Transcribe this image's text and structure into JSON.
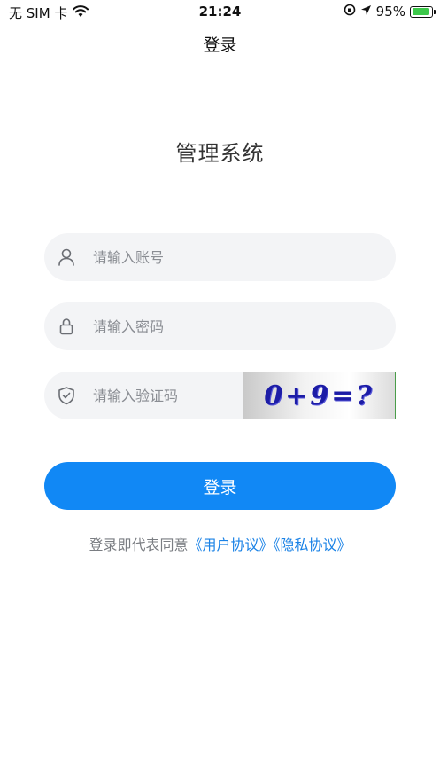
{
  "status_bar": {
    "carrier": "无 SIM 卡",
    "time": "21:24",
    "battery": "95%",
    "battery_level": 0.95
  },
  "nav": {
    "title": "登录"
  },
  "app": {
    "title": "管理系统"
  },
  "form": {
    "username_placeholder": "请输入账号",
    "password_placeholder": "请输入密码",
    "captcha_placeholder": "请输入验证码",
    "captcha_image_text": "0+9=?"
  },
  "login_button": {
    "label": "登录"
  },
  "agreement": {
    "prefix": "登录即代表同意",
    "user_agreement": "《用户协议》",
    "privacy_policy": "《隐私协议》"
  },
  "colors": {
    "primary": "#1188f5",
    "link": "#1a82e6",
    "input_bg": "#f3f4f6"
  }
}
